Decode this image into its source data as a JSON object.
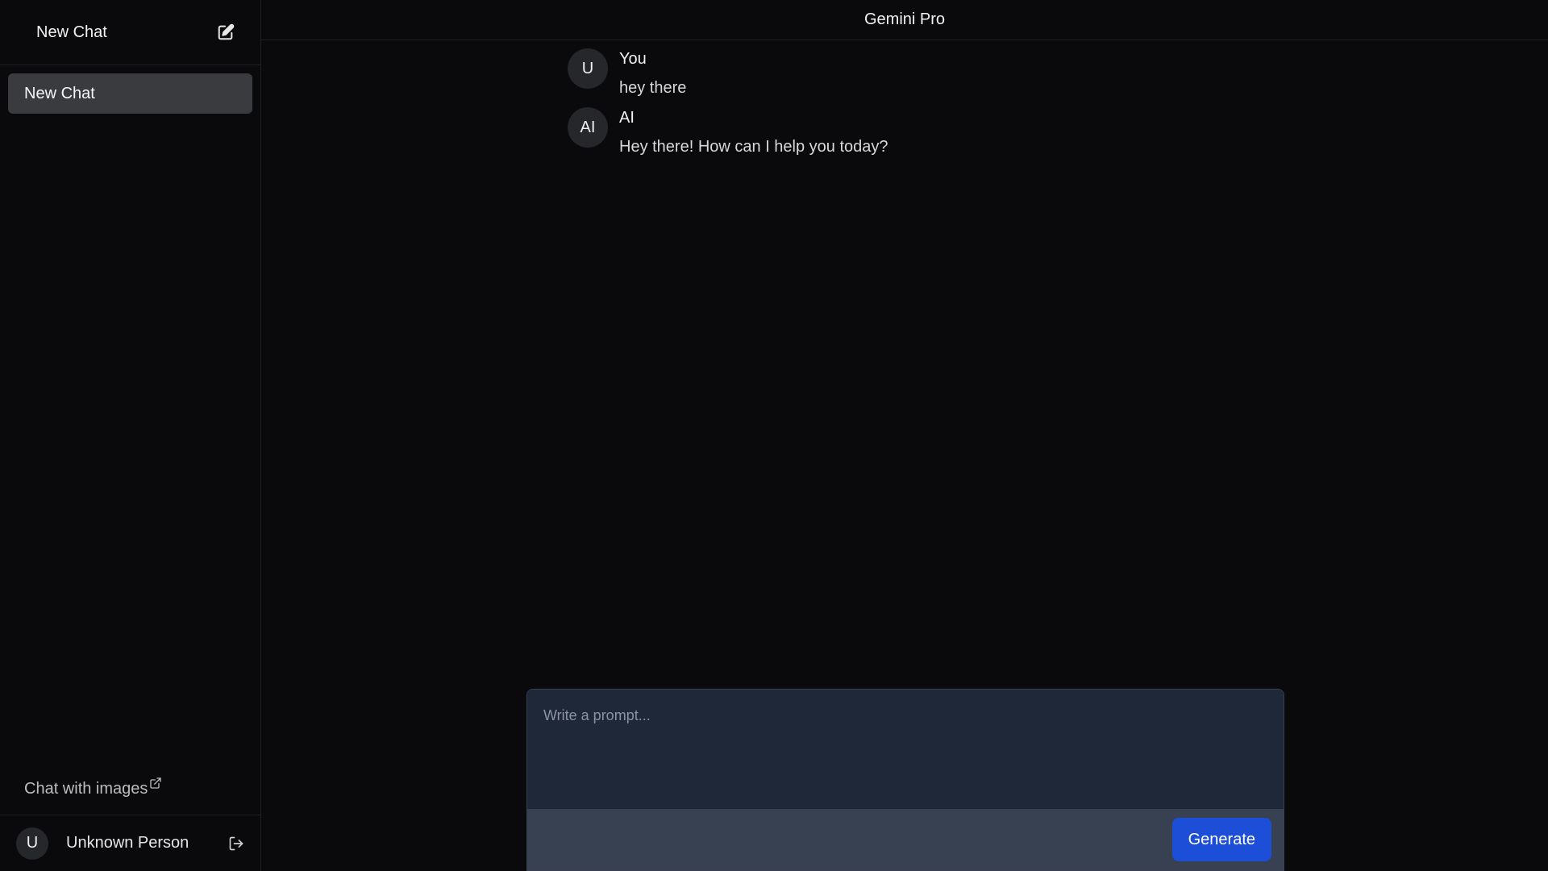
{
  "sidebar": {
    "header_title": "New Chat",
    "new_chat_icon": "edit-icon",
    "chats": [
      {
        "label": "New Chat"
      }
    ],
    "link_label": "Chat with images",
    "link_icon": "external-link-icon",
    "user": {
      "avatar_initial": "U",
      "name": "Unknown Person",
      "logout_icon": "logout-icon"
    }
  },
  "topbar": {
    "title": "Gemini Pro"
  },
  "messages": [
    {
      "avatar": "U",
      "author": "You",
      "text": "hey there"
    },
    {
      "avatar": "AI",
      "author": "AI",
      "text": "Hey there! How can I help you today?"
    }
  ],
  "composer": {
    "placeholder": "Write a prompt...",
    "value": "",
    "button_label": "Generate"
  },
  "colors": {
    "background": "#0a0a0c",
    "active_chat": "#3a3b3f",
    "composer_bg": "#1f2838",
    "composer_footer": "#374151",
    "accent": "#1d4ed8"
  }
}
